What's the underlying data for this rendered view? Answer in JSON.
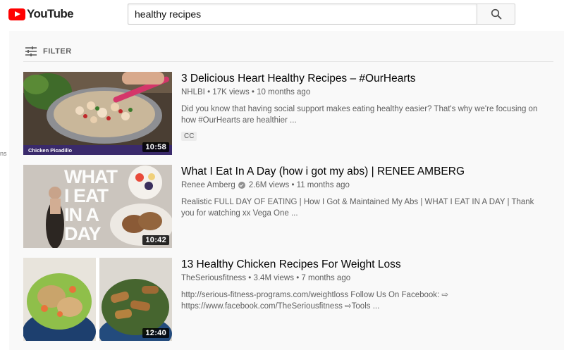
{
  "header": {
    "logo_text": "YouTube",
    "search_value": "healthy recipes",
    "search_icon": "search-icon",
    "accent_color": "#ff0000"
  },
  "filter": {
    "label": "FILTER",
    "icon": "sliders-icon"
  },
  "side_fragment": "ns",
  "results": [
    {
      "title": "3 Delicious Heart Healthy Recipes – #OurHearts",
      "channel": "NHLBI",
      "views": "17K views",
      "age": "10 months ago",
      "description": "Did you know that having social support makes eating healthy easier? That's why we're focusing on how #OurHearts are healthier ...",
      "badge": "CC",
      "duration": "10:58",
      "thumb_caption": "Chicken Picadillo"
    },
    {
      "title": "What I Eat In A Day (how i got my abs) | RENEE AMBERG",
      "channel": "Renee Amberg",
      "views": "2.6M views",
      "age": "11 months ago",
      "description": "Realistic FULL DAY OF EATING | How I Got & Maintained My Abs | WHAT I EAT IN A DAY | Thank you for watching xx Vega One ...",
      "duration": "10:42",
      "thumb_text": [
        "WHAT",
        "I EAT",
        "IN A",
        "DAY"
      ]
    },
    {
      "title": "13 Healthy Chicken Recipes For Weight Loss",
      "channel": "TheSeriousfitness",
      "views": "3.4M views",
      "age": "7 months ago",
      "description": "http://serious-fitness-programs.com/weightloss Follow Us On Facebook: ⇨ https://www.facebook.com/TheSeriousfitness ⇨Tools ...",
      "duration": "12:40"
    }
  ]
}
